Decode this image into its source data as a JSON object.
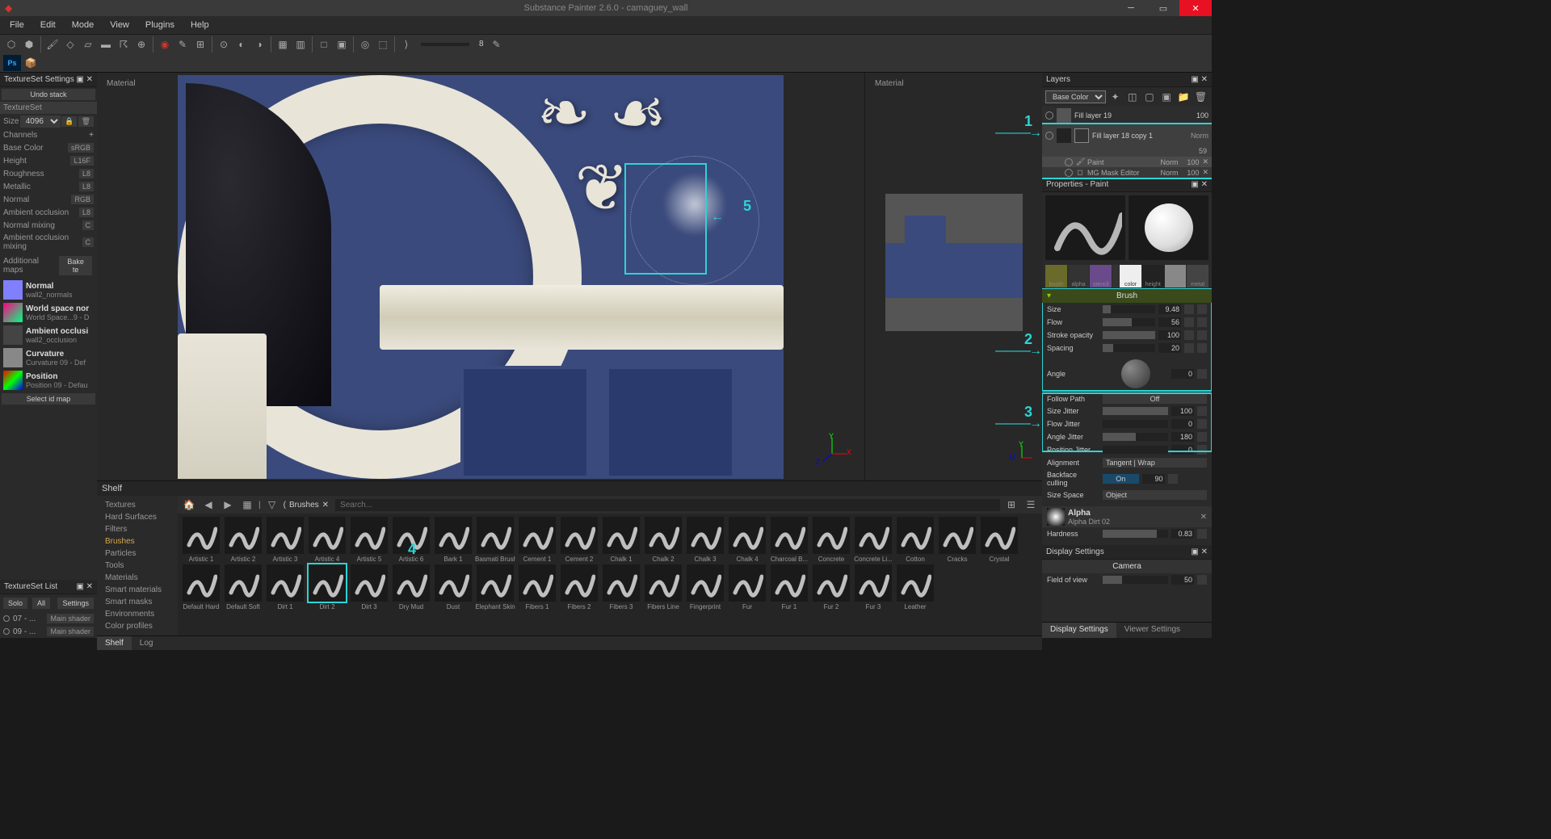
{
  "app": {
    "title": "Substance Painter 2.6.0 - camaguey_wall"
  },
  "menu": [
    "File",
    "Edit",
    "Mode",
    "View",
    "Plugins",
    "Help"
  ],
  "leftpanel": {
    "texset_settings": "TextureSet Settings",
    "undo_stack": "Undo stack",
    "textureset": "TextureSet",
    "size_label": "Size",
    "size_value": "4096",
    "channels_label": "Channels",
    "channels": [
      {
        "name": "Base Color",
        "fmt": "sRGB"
      },
      {
        "name": "Height",
        "fmt": "L16F"
      },
      {
        "name": "Roughness",
        "fmt": "L8"
      },
      {
        "name": "Metallic",
        "fmt": "L8"
      },
      {
        "name": "Normal",
        "fmt": "RGB"
      },
      {
        "name": "Ambient occlusion",
        "fmt": "L8"
      }
    ],
    "normal_mixing": "Normal mixing",
    "ao_mixing": "Ambient occlusion mixing",
    "additional_maps": "Additional maps",
    "bake_btn": "Bake te",
    "maps": [
      {
        "title": "Normal",
        "sub": "wall2_normals",
        "cls": ""
      },
      {
        "title": "World space nor",
        "sub": "World Space...9 - D",
        "cls": "ws"
      },
      {
        "title": "Ambient occlusi",
        "sub": "wall2_occlusion",
        "cls": "ao"
      },
      {
        "title": "Curvature",
        "sub": "Curvature 09 - Def",
        "cls": "cv"
      },
      {
        "title": "Position",
        "sub": "Position 09 - Defau",
        "cls": "pos"
      }
    ],
    "select_id": "Select id map",
    "tslist": "TextureSet List",
    "ts_buttons": [
      "Solo",
      "All",
      "Settings"
    ],
    "ts_items": [
      {
        "name": "07 - ...",
        "shader": "Main shader"
      },
      {
        "name": "09 - ...",
        "shader": "Main shader"
      }
    ]
  },
  "viewport": {
    "main_label": "Material",
    "side_label": "Material"
  },
  "annotations": {
    "n1": "1",
    "n2": "2",
    "n3": "3",
    "n4": "4",
    "n5": "5"
  },
  "shelf": {
    "title": "Shelf",
    "breadcrumb": "Brushes",
    "search_ph": "Search...",
    "categories": [
      "Textures",
      "Hard Surfaces",
      "Filters",
      "Brushes",
      "Particles",
      "Tools",
      "Materials",
      "Smart materials",
      "Smart masks",
      "Environments",
      "Color profiles"
    ],
    "active_cat": "Brushes",
    "items_row1": [
      "Artistic 1",
      "Artistic 2",
      "Artistic 3",
      "Artistic 4",
      "Artistic 5",
      "Artistic 6",
      "Bark 1",
      "Basmati Brush",
      "Cement 1",
      "Cement 2",
      "Chalk 1",
      "Chalk 2",
      "Chalk 3",
      "Chalk 4",
      "Charcoal B...",
      "Concrete",
      "Concrete Li...",
      "Cotton",
      "Cracks"
    ],
    "items_row2": [
      "Crystal",
      "Default Hard",
      "Default Soft",
      "Dirt 1",
      "Dirt 2",
      "Dirt 3",
      "Dry Mud",
      "Dust",
      "Elephant Skin",
      "Fibers 1",
      "Fibers 2",
      "Fibers 3",
      "Fibers Line",
      "Fingerprint",
      "Fur",
      "Fur 1",
      "Fur 2",
      "Fur 3",
      "Leather"
    ],
    "selected": "Dirt 2",
    "tabs": [
      "Shelf",
      "Log"
    ]
  },
  "layers": {
    "title": "Layers",
    "mode": "Base Color",
    "l0": {
      "name": "Fill layer 19",
      "op": "100"
    },
    "l1": {
      "name": "Fill layer 18 copy 1",
      "mode": "Norm",
      "op": "59"
    },
    "fx1": {
      "name": "Paint",
      "mode": "Norm",
      "op": "100"
    },
    "fx2": {
      "name": "MG Mask Editor",
      "mode": "Norm",
      "op": "100"
    }
  },
  "properties": {
    "title": "Properties - Paint",
    "mat_tabs": [
      "brush",
      "alpha",
      "stencil"
    ],
    "mat_out": [
      "color",
      "height",
      "rough",
      "metal"
    ],
    "brush_hdr": "Brush",
    "params": [
      {
        "lbl": "Size",
        "val": "9.48",
        "fill": 16
      },
      {
        "lbl": "Flow",
        "val": "56",
        "fill": 56
      },
      {
        "lbl": "Stroke opacity",
        "val": "100",
        "fill": 100
      },
      {
        "lbl": "Spacing",
        "val": "20",
        "fill": 20
      }
    ],
    "angle_lbl": "Angle",
    "angle_val": "0",
    "follow_path": "Follow Path",
    "follow_val": "Off",
    "jitter": [
      {
        "lbl": "Size Jitter",
        "val": "100",
        "fill": 100
      },
      {
        "lbl": "Flow Jitter",
        "val": "0",
        "fill": 0
      },
      {
        "lbl": "Angle Jitter",
        "val": "180",
        "fill": 50
      },
      {
        "lbl": "Position Jitter",
        "val": "0",
        "fill": 0
      }
    ],
    "alignment_lbl": "Alignment",
    "alignment_val": "Tangent | Wrap",
    "backface_lbl": "Backface culling",
    "backface_on": "On",
    "backface_angle": "90",
    "sizespace_lbl": "Size Space",
    "sizespace_val": "Object",
    "alpha_hdr": "Alpha",
    "alpha_name": "Alpha Dirt 02",
    "hardness_lbl": "Hardness",
    "hardness_val": "0.83"
  },
  "display": {
    "title": "Display Settings",
    "camera": "Camera",
    "fov_lbl": "Field of view",
    "fov_val": "50",
    "tabs": [
      "Display Settings",
      "Viewer Settings"
    ]
  }
}
